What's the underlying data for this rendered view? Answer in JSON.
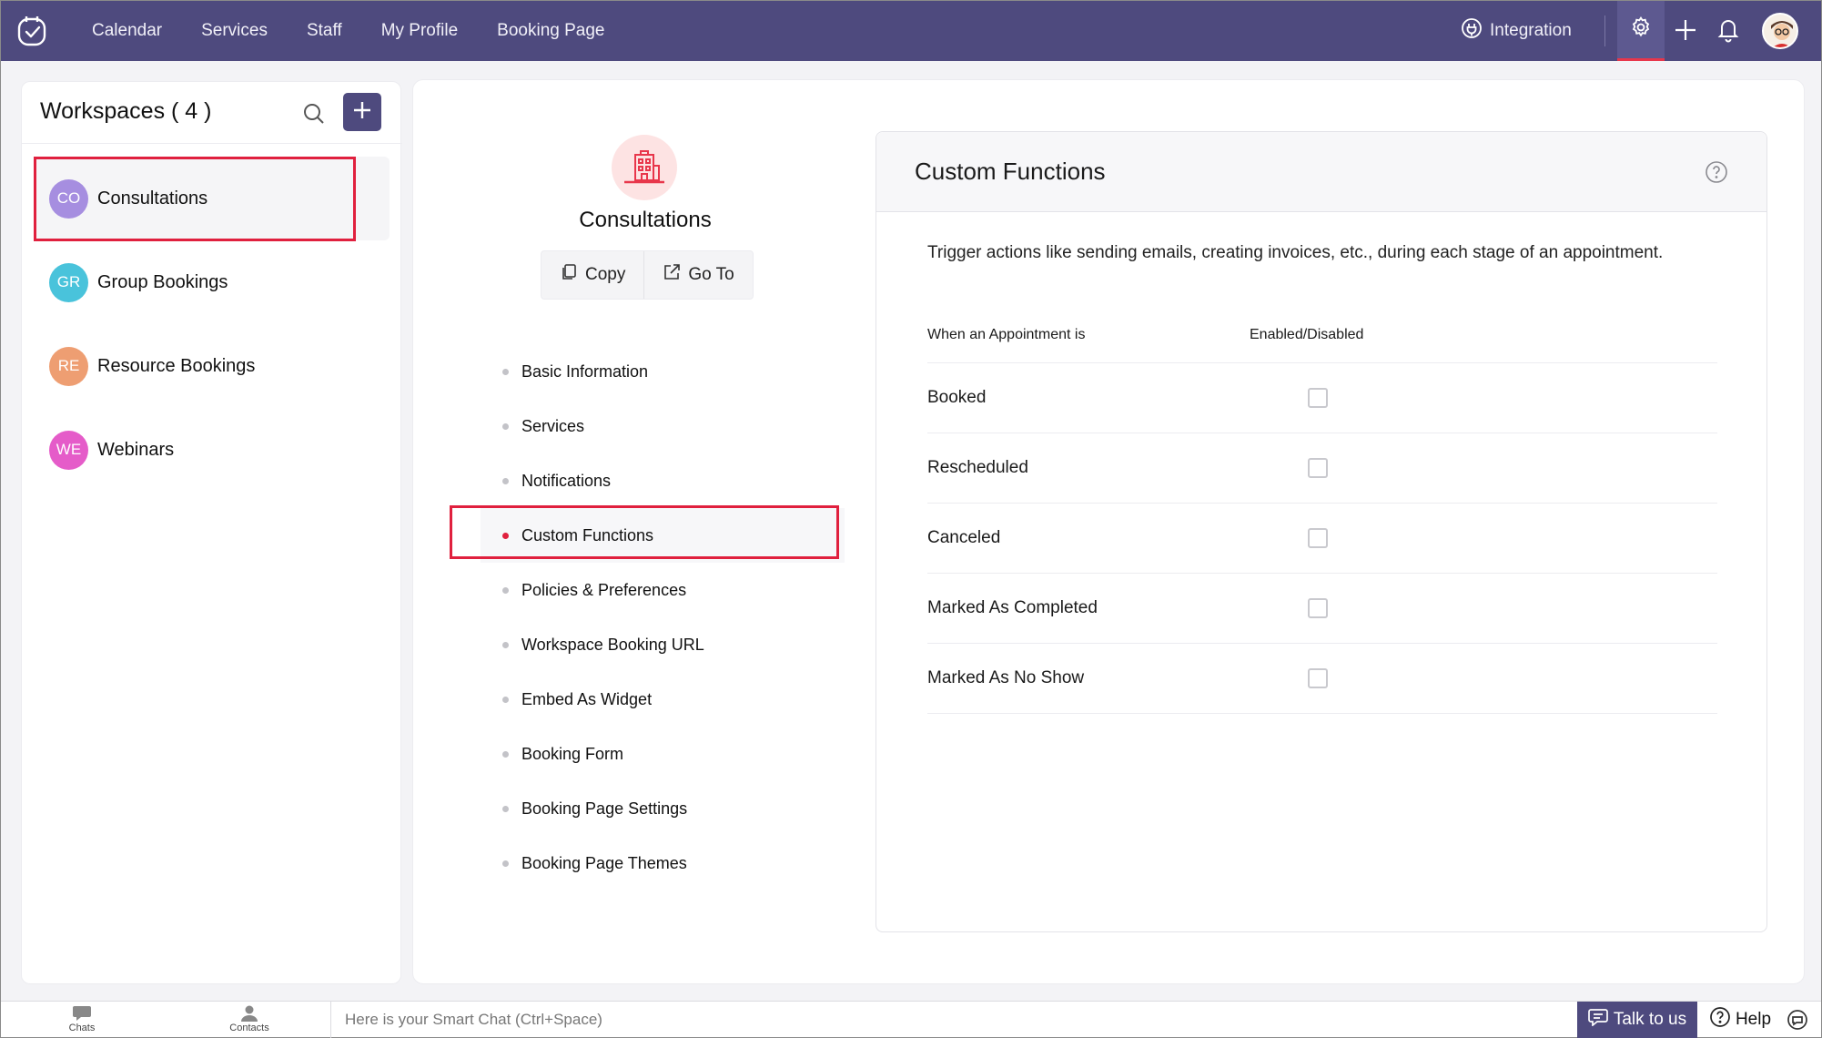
{
  "nav": {
    "items": [
      "Calendar",
      "Services",
      "Staff",
      "My Profile",
      "Booking Page"
    ],
    "integration_label": "Integration"
  },
  "workspaces": {
    "title": "Workspaces ( 4 )",
    "items": [
      {
        "initials": "CO",
        "label": "Consultations",
        "color": "#a68ee0",
        "active": true
      },
      {
        "initials": "GR",
        "label": "Group Bookings",
        "color": "#49c3db",
        "active": false
      },
      {
        "initials": "RE",
        "label": "Resource Bookings",
        "color": "#ee9e72",
        "active": false
      },
      {
        "initials": "WE",
        "label": "Webinars",
        "color": "#e55cc9",
        "active": false
      }
    ]
  },
  "workspace_detail": {
    "name": "Consultations",
    "copy_label": "Copy",
    "goto_label": "Go To",
    "menu": [
      "Basic Information",
      "Services",
      "Notifications",
      "Custom Functions",
      "Policies & Preferences",
      "Workspace Booking URL",
      "Embed As Widget",
      "Booking Form",
      "Booking Page Settings",
      "Booking Page Themes"
    ],
    "active_menu": "Custom Functions"
  },
  "custom_functions": {
    "title": "Custom Functions",
    "description": "Trigger actions like sending emails, creating invoices, etc., during each stage of an appointment.",
    "col_when": "When an Appointment is",
    "col_enabled": "Enabled/Disabled",
    "rows": [
      {
        "label": "Booked",
        "enabled": false
      },
      {
        "label": "Rescheduled",
        "enabled": false
      },
      {
        "label": "Canceled",
        "enabled": false
      },
      {
        "label": "Marked As Completed",
        "enabled": false
      },
      {
        "label": "Marked As No Show",
        "enabled": false
      }
    ]
  },
  "bottombar": {
    "chats_label": "Chats",
    "contacts_label": "Contacts",
    "smartchat_placeholder": "Here is your Smart Chat (Ctrl+Space)",
    "talk_label": "Talk to us",
    "help_label": "Help"
  },
  "colors": {
    "brand": "#4e4a7e",
    "highlight": "#e0203e"
  }
}
